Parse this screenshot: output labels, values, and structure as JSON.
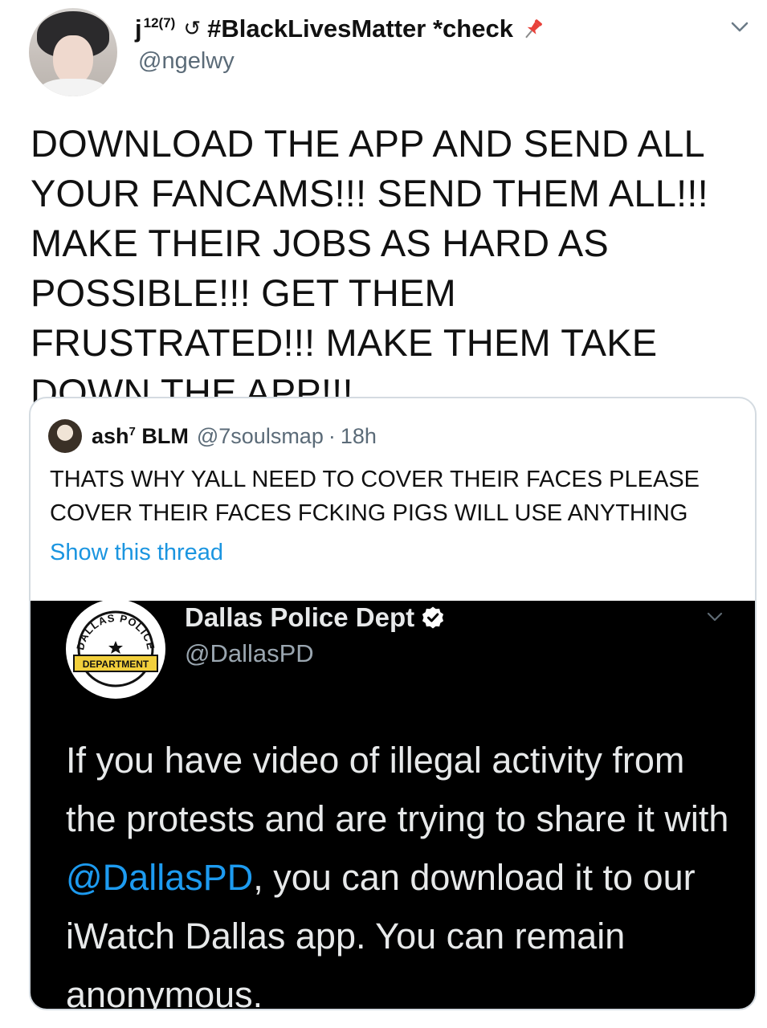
{
  "tweet": {
    "display_name": "j",
    "display_name_sup": "12(7)",
    "name_hashtag": "#BlackLivesMatter *check",
    "handle": "@ngelwy",
    "text": "DOWNLOAD THE APP AND SEND ALL YOUR FANCAMS!!! SEND THEM ALL!!! MAKE THEIR JOBS AS HARD AS POSSIBLE!!! GET THEM FRUSTRATED!!! MAKE THEM TAKE DOWN THE APP!!!"
  },
  "quoted": {
    "name": "ash",
    "name_sup": "7",
    "name_tail": " BLM",
    "handle": "@7soulsmap",
    "separator": "·",
    "time": "18h",
    "text": "THATS WHY YALL NEED TO COVER THEIR FACES PLEASE COVER THEIR FACES FCKING PIGS WILL USE ANYTHING",
    "show_thread": "Show this thread"
  },
  "embedded": {
    "logo_top": "DALLAS POLICE",
    "logo_band": "DEPARTMENT",
    "name": "Dallas Police Dept",
    "handle": "@DallasPD",
    "text_before": "If you have video of illegal activity from the protests and are trying to share it with ",
    "mention": "@DallasPD",
    "text_after": ", you can download it to our iWatch Dallas app. You can remain anonymous."
  },
  "colors": {
    "link": "#1b95e0",
    "secondary_text": "#5b6b78",
    "card_border": "#d4dbe1",
    "dark_bg": "#000000"
  },
  "icons": {
    "refresh": "refresh-icon",
    "pin": "pushpin-icon",
    "chevron": "chevron-down-icon",
    "verified": "verified-badge-icon"
  }
}
